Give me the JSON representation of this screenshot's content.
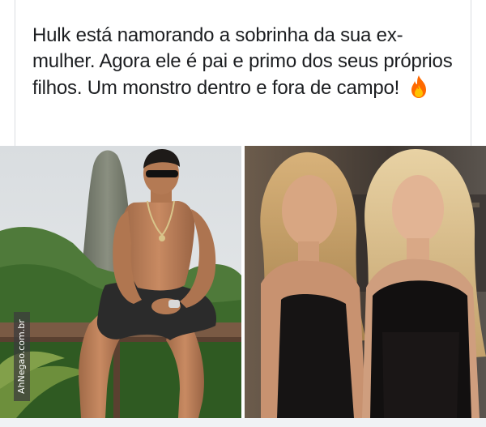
{
  "post": {
    "text": "Hulk está namorando a sobrinha da sua ex-mulher. Agora ele é pai e primo dos seus próprios filhos. Um monstro dentro e fora de campo!",
    "emoji_icon": "fire-icon"
  },
  "watermark": {
    "text": "AhNegao.com.br"
  },
  "photos": {
    "left_description_icon": "photo-man-on-cliff",
    "right_description_icon": "photo-two-women"
  },
  "colors": {
    "text": "#1c1e21",
    "background": "#ffffff",
    "page_bg": "#f0f2f5",
    "fire": "#ff6a00"
  }
}
